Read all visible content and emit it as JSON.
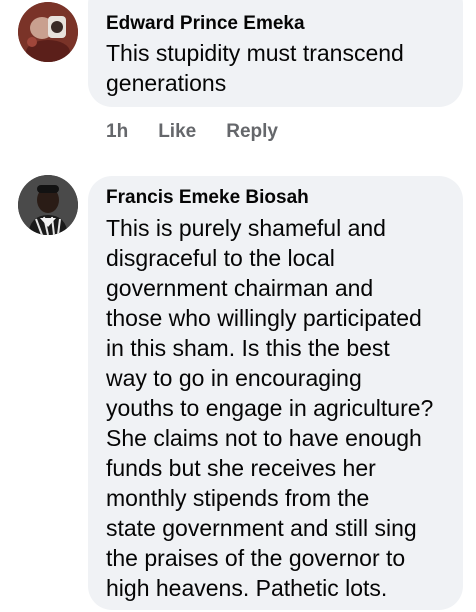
{
  "comments": [
    {
      "author": "Edward Prince Emeka",
      "text_lines": [
        "This stupidity must transcend",
        "generations"
      ],
      "time": "1h",
      "like_label": "Like",
      "reply_label": "Reply"
    },
    {
      "author": "Francis Emeke Biosah",
      "text_lines": [
        "This is purely shameful and",
        "disgraceful to the local",
        "government chairman and",
        "those who willingly participated",
        "in this sham. Is this the best",
        "way to go in encouraging",
        "youths to engage in agriculture?",
        "She claims not to have enough",
        "funds but she receives her",
        "monthly stipends from the",
        "state government and still sing",
        "the praises of the governor to",
        "high heavens. Pathetic lots."
      ]
    }
  ],
  "colors": {
    "bubble_background": "#f0f2f5",
    "text": "#050505",
    "secondary_text": "#65676b"
  }
}
